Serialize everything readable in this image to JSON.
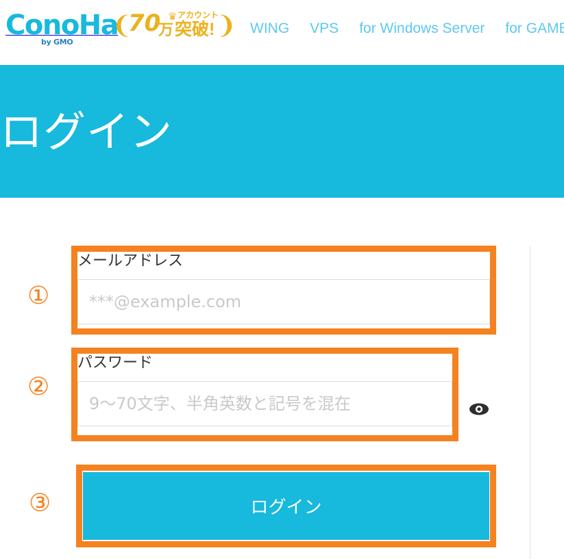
{
  "header": {
    "logo": {
      "word": "ConoHa",
      "sub": "by GMO",
      "name": "conoha-logo"
    },
    "badge": {
      "number": "70",
      "unit": "万",
      "small_text": "アカウント",
      "big_text": "突破!",
      "crown_icon": "crown-icon",
      "laurel_left_icon": "laurel-left-icon",
      "laurel_right_icon": "laurel-right-icon",
      "laurel_left_glyph": "❨",
      "laurel_right_glyph": "❩",
      "crown_glyph": "♛"
    },
    "nav": [
      {
        "label": "WING"
      },
      {
        "label": "VPS"
      },
      {
        "label": "for Windows Server"
      },
      {
        "label": "for GAME"
      }
    ]
  },
  "hero": {
    "title": "ログイン"
  },
  "form": {
    "steps": {
      "one": "①",
      "two": "②",
      "three": "③"
    },
    "email": {
      "label": "メールアドレス",
      "placeholder": "***@example.com",
      "value": ""
    },
    "password": {
      "label": "パスワード",
      "placeholder": "9〜70文字、半角英数と記号を混在",
      "value": "",
      "toggle_icon": "eye-icon"
    },
    "submit": {
      "label": "ログイン"
    }
  },
  "colors": {
    "brand_cyan": "#17b9dd",
    "nav_link_blue": "#5ec8ef",
    "annotation_orange": "#f58220",
    "badge_gold": "#ecb11f",
    "logo_sub_blue": "#2b7fc4",
    "placeholder_gray": "#c9c9c9",
    "divider_gray": "#e2e2e2"
  }
}
